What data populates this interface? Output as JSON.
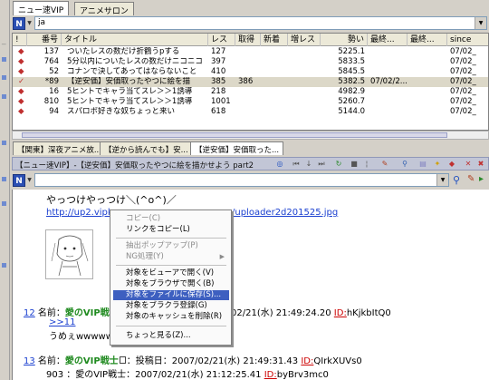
{
  "top_tabs": [
    "ニュー速VIP",
    "アニメサロン"
  ],
  "filter1": {
    "button": "N",
    "value": "ja"
  },
  "list": {
    "headers": [
      "!",
      "番号",
      "タイトル",
      "レス",
      "取得",
      "新着",
      "増レス",
      "勢い",
      "最終...",
      "最終...",
      "since"
    ],
    "rows": [
      {
        "mark": "◆",
        "num": "137",
        "title": "ついたレスの数だけ折鶴うpする",
        "res": "127",
        "got": "",
        "new": "",
        "inc": "",
        "vel": "5225.1",
        "since": "07/02_"
      },
      {
        "mark": "◆",
        "num": "764",
        "title": "5分以内についたレスの数だけニコニコ",
        "res": "397",
        "got": "",
        "new": "",
        "inc": "",
        "vel": "5833.5",
        "since": "07/02_"
      },
      {
        "mark": "◆",
        "num": "52",
        "title": "コナンで決してあってはならないこと",
        "res": "410",
        "got": "",
        "new": "",
        "inc": "",
        "vel": "5845.5",
        "since": "07/02_"
      },
      {
        "mark": "✓",
        "num": "*89",
        "title": "【逆安価】安価取ったやつに絵を描",
        "res": "385",
        "got": "386",
        "new": "",
        "inc": "",
        "vel": "5382.5",
        "last": "07/02/2...",
        "since": "07/02_"
      },
      {
        "mark": "◆",
        "num": "16",
        "title": "5ヒントでキャラ当てスレ＞＞1誘導",
        "res": "218",
        "got": "",
        "new": "",
        "inc": "",
        "vel": "4982.9",
        "since": "07/02_"
      },
      {
        "mark": "◆",
        "num": "810",
        "title": "5ヒントでキャラ当てスレ＞＞1誘導",
        "res": "1001",
        "got": "",
        "new": "",
        "inc": "",
        "vel": "5260.7",
        "since": "07/02_"
      },
      {
        "mark": "◆",
        "num": "94",
        "title": "スパロボ好きな奴ちょっと来い",
        "res": "618",
        "got": "",
        "new": "",
        "inc": "",
        "vel": "5144.0",
        "since": "07/02_"
      }
    ]
  },
  "bottom_tabs": [
    "【関東】深夜アニメ放...",
    "【逆から読んでも】安...",
    "【逆安価】安価取った..."
  ],
  "viewer_title": "【ニュー速VIP】-【逆安価】安価取ったやつに絵を描かせよう part2",
  "filter2": {
    "button": "N",
    "value": ""
  },
  "post": {
    "aa": "やっつけやっつけ＼(^o^)／",
    "url_a": "http://up2.vipk",
    "url_b": "/uploader2d201525.jpg",
    "p12_num": "12",
    "p12_label": "名前：",
    "p12_name": "愛のVIP戦",
    "p12_meta": "02/21(水) 21:49:24.20 ",
    "p12_id_label": "ID:",
    "p12_id": "hKjkbItQ0",
    "p12_anchor": ">>11",
    "p12_body": "うめぇwwwwww",
    "p13_num": "13",
    "p13_label": "名前：",
    "p13_name": "愛のVIP戦士",
    "p13_mid": "：投稿日：2007/02/21(水) 21:49:31.43 ",
    "p13_id_label": "ID:",
    "p13_id": "QIrkXUVs0",
    "p13_body": "903 ：愛のVIP戦士：2007/02/21(水) 21:12:25.41 ",
    "p13_body_id_label": "ID:",
    "p13_body_id": "byBrv3mc0"
  },
  "context_menu": {
    "items": [
      {
        "label": "コピー(C)",
        "disabled": true
      },
      {
        "label": "リンクをコピー(L)",
        "disabled": false
      },
      {
        "label": "抽出ポップアップ(P)",
        "disabled": true
      },
      {
        "label": "NG処理(Y)",
        "disabled": true,
        "submenu": true
      },
      {
        "label": "対象をビューアで開く(V)",
        "disabled": false
      },
      {
        "label": "対象をブラウザで開く(B)",
        "disabled": false
      },
      {
        "label": "対象をファイルに保存(S)...",
        "disabled": false,
        "highlighted": true
      },
      {
        "label": "対象をブラクラ登録(G)",
        "disabled": false
      },
      {
        "label": "対象のキャッシュを削除(R)",
        "disabled": false
      },
      {
        "label": "ちょっと見る(Z)...",
        "disabled": false
      }
    ]
  },
  "colors": {
    "accent": "#3d5fc0",
    "link": "#1a3fd0",
    "name": "#1f8a1f",
    "id": "#cc0000"
  }
}
